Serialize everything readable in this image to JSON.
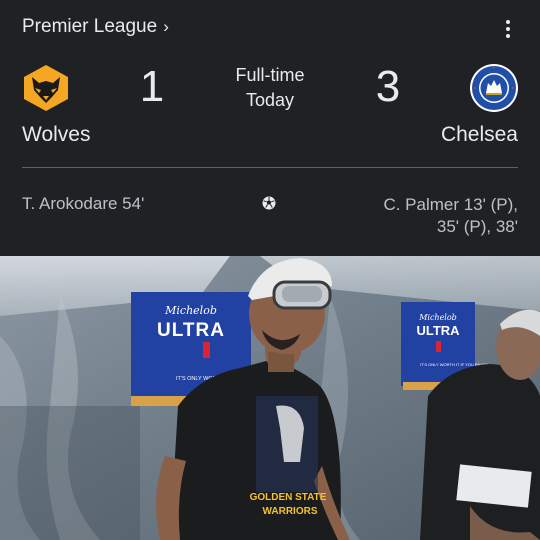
{
  "match": {
    "league": "Premier League",
    "status_line1": "Full-time",
    "status_line2": "Today",
    "home": {
      "name": "Wolves",
      "score": "1",
      "scorers": "T. Arokodare 54'"
    },
    "away": {
      "name": "Chelsea",
      "score": "3",
      "scorers_line1": "C. Palmer 13' (P),",
      "scorers_line2": "35' (P), 38'"
    }
  },
  "icons": {
    "league_link": "chevron-right-icon",
    "more": "more-vert-icon",
    "home_crest": "wolves-crest-icon",
    "away_crest": "chelsea-crest-icon",
    "goals": "soccer-ball-icon"
  },
  "colors": {
    "background": "#202124",
    "text": "#e8eaed",
    "secondary_text": "#bdc1c6",
    "wolves_gold": "#f5a623",
    "chelsea_blue": "#1f4fa8"
  },
  "photo": {
    "banner_brand": "Michelob",
    "banner_title": "ULTRA",
    "banner_small": "IT'S ONLY WORTH IT IF YOU ENJOY",
    "shirt_text_1": "GOLDEN STATE",
    "shirt_text_2": "WARRIORS"
  }
}
